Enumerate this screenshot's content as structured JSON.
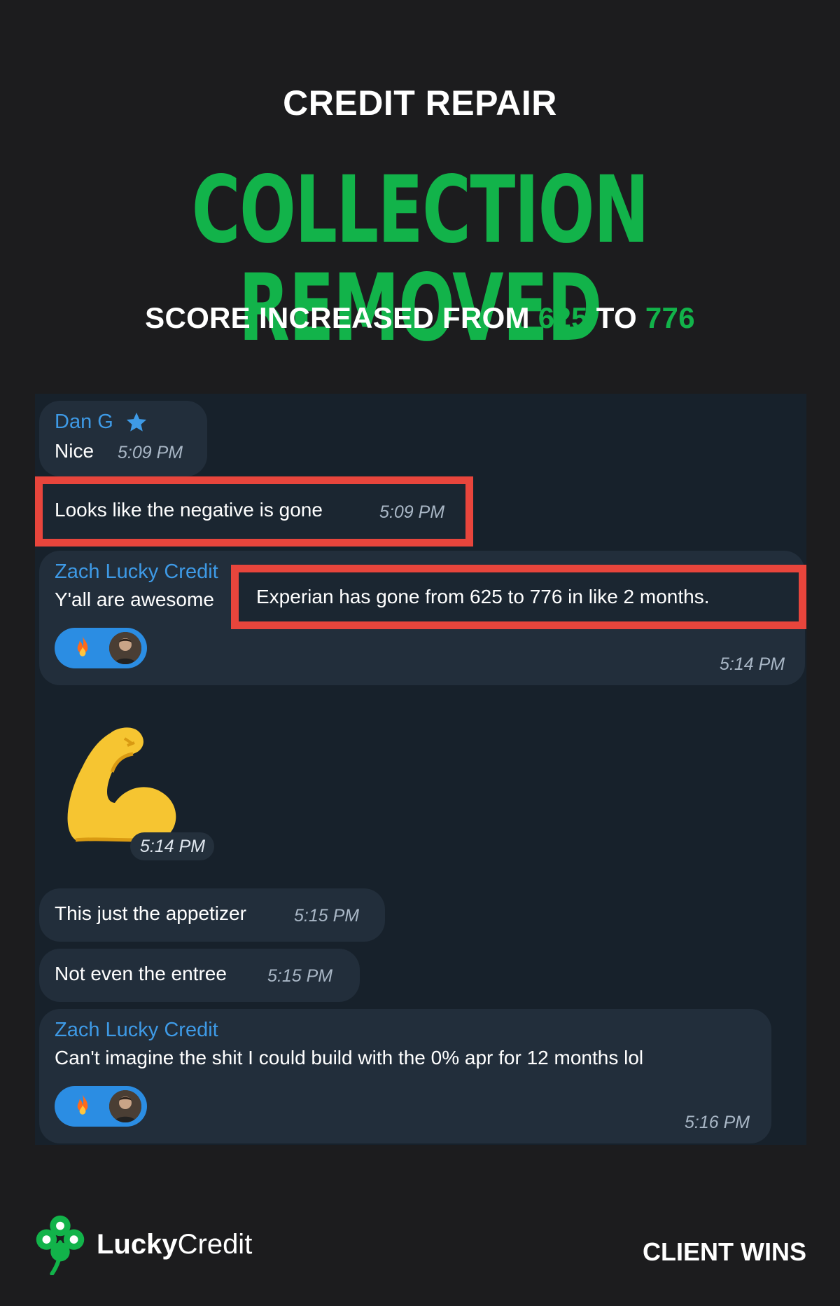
{
  "header": {
    "kicker": "CREDIT REPAIR",
    "headline": "COLLECTION REMOVED",
    "subline_prefix": "SCORE INCREASED FROM ",
    "score_from": "625",
    "subline_mid": " TO ",
    "score_to": "776"
  },
  "chat": {
    "msg1": {
      "sender": "Dan G",
      "text": "Nice",
      "time": "5:09 PM"
    },
    "msg2": {
      "text": "Looks like the negative is gone",
      "time": "5:09 PM"
    },
    "msg3": {
      "sender": "Zach Lucky Credit",
      "text": "Y'all are awesome",
      "highlight": "Experian has gone from 625 to 776 in like 2 months.",
      "time": "5:14 PM",
      "reaction_icon": "fire-icon"
    },
    "sticker": {
      "icon": "flexed-biceps-icon",
      "time": "5:14 PM"
    },
    "msg4": {
      "text": "This just the appetizer",
      "time": "5:15 PM"
    },
    "msg5": {
      "text": "Not even the entree",
      "time": "5:15 PM"
    },
    "msg6": {
      "sender": "Zach Lucky Credit",
      "text": "Can't imagine the shit I could build with the 0% apr for 12 months lol",
      "time": "5:16 PM",
      "reaction_icon": "fire-icon"
    }
  },
  "footer": {
    "logo_lucky": "Lucky",
    "logo_credit": "Credit",
    "tagline": "CLIENT WINS"
  },
  "colors": {
    "background": "#1c1c1e",
    "accent_green": "#12b34a",
    "highlight_red": "#e8453c",
    "chat_bg": "#17212b",
    "bubble": "#222e3b",
    "sender_blue": "#3e9ae6",
    "reaction_blue": "#2b8de3"
  }
}
